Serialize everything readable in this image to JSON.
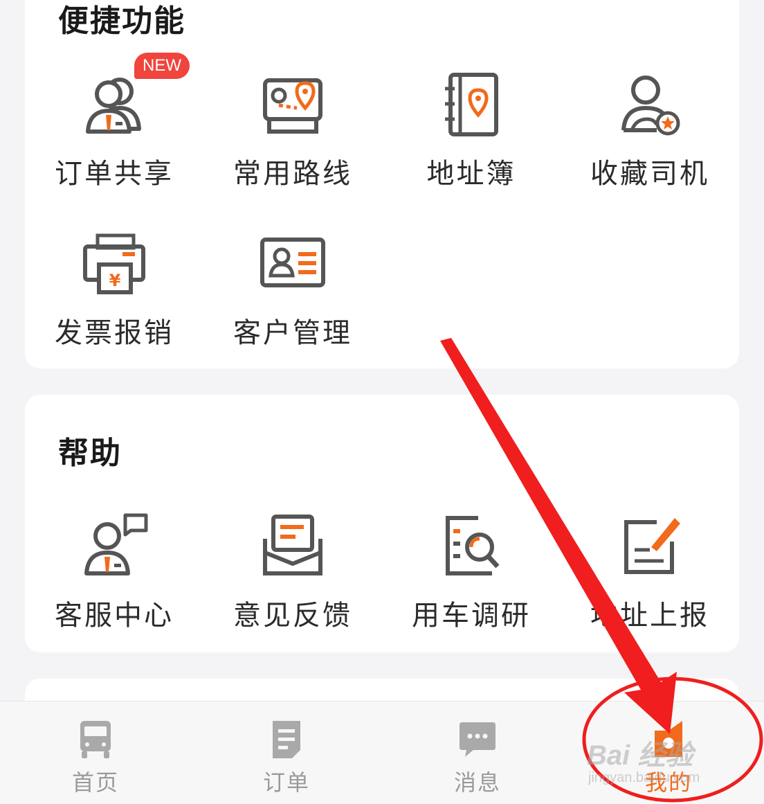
{
  "quick_features": {
    "title": "便捷功能",
    "items": [
      {
        "label": "订单共享",
        "icon": "order-share-icon",
        "badge": "NEW"
      },
      {
        "label": "常用路线",
        "icon": "frequent-route-icon"
      },
      {
        "label": "地址簿",
        "icon": "address-book-icon"
      },
      {
        "label": "收藏司机",
        "icon": "favorite-driver-icon"
      },
      {
        "label": "发票报销",
        "icon": "invoice-icon"
      },
      {
        "label": "客户管理",
        "icon": "customer-management-icon"
      }
    ]
  },
  "help": {
    "title": "帮助",
    "items": [
      {
        "label": "客服中心",
        "icon": "customer-service-icon"
      },
      {
        "label": "意见反馈",
        "icon": "feedback-icon"
      },
      {
        "label": "用车调研",
        "icon": "survey-icon"
      },
      {
        "label": "地址上报",
        "icon": "address-report-icon"
      }
    ]
  },
  "tabbar": {
    "tabs": [
      {
        "label": "首页",
        "icon": "truck-icon"
      },
      {
        "label": "订单",
        "icon": "order-doc-icon"
      },
      {
        "label": "消息",
        "icon": "chat-bubble-icon"
      },
      {
        "label": "我的",
        "icon": "profile-icon",
        "active": true
      }
    ]
  },
  "watermark": {
    "brand": "Bai 经验",
    "url": "jingyan.baidu.com"
  },
  "colors": {
    "accent": "#f26a1b",
    "icon_gray": "#555555",
    "annotation": "#f01e1e",
    "badge": "#f0443c"
  }
}
